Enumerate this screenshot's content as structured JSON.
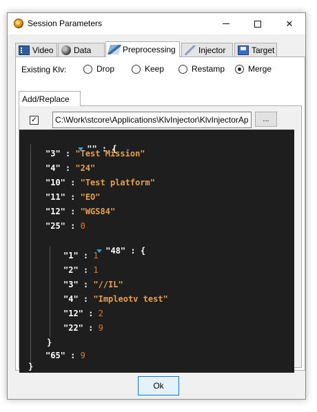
{
  "window": {
    "title": "Session Parameters"
  },
  "tabs": [
    {
      "label": "Video",
      "icon": "video-icon"
    },
    {
      "label": "Data",
      "icon": "data-icon"
    },
    {
      "label": "Preprocessing",
      "icon": "preprocessing-icon",
      "active": true
    },
    {
      "label": "Injector",
      "icon": "injector-icon"
    },
    {
      "label": "Target",
      "icon": "target-icon"
    }
  ],
  "existing_klv": {
    "label": "Existing Klv:",
    "options": [
      "Drop",
      "Keep",
      "Restamp",
      "Merge"
    ],
    "selected": "Merge"
  },
  "subtab": {
    "label": "Add/Replace"
  },
  "file": {
    "checked": true,
    "check_mark": "✓",
    "path": "C:\\Work\\stcore\\Applications\\KlvInjector\\KlvInjectorAp",
    "browse_label": "..."
  },
  "json_tree": {
    "root_key": "\"\"",
    "open_brace": "{",
    "close_brace": "}",
    "colon": " : ",
    "entries": [
      {
        "key": "\"3\"",
        "value": "\"Test Mission\""
      },
      {
        "key": "\"4\"",
        "value": "\"24\""
      },
      {
        "key": "\"10\"",
        "value": "\"Test platform\""
      },
      {
        "key": "\"11\"",
        "value": "\"EO\""
      },
      {
        "key": "\"12\"",
        "value": "\"WGS84\""
      },
      {
        "key": "\"25\"",
        "value": "0"
      }
    ],
    "nested_key": "\"48\"",
    "nested_entries": [
      {
        "key": "\"1\"",
        "value": "1"
      },
      {
        "key": "\"2\"",
        "value": "1"
      },
      {
        "key": "\"3\"",
        "value": "\"//IL\""
      },
      {
        "key": "\"4\"",
        "value": "\"Impleotv test\""
      },
      {
        "key": "\"12\"",
        "value": "2"
      },
      {
        "key": "\"22\"",
        "value": "9"
      }
    ],
    "last_entry": {
      "key": "\"65\"",
      "value": "9"
    }
  },
  "footer": {
    "ok_label": "Ok"
  },
  "colors": {
    "json_background": "#1e1e1e",
    "string_value": "#e8a050",
    "number_value": "#e07a28",
    "toggle_arrow": "#29a8e0",
    "ok_border": "#0078d7"
  }
}
